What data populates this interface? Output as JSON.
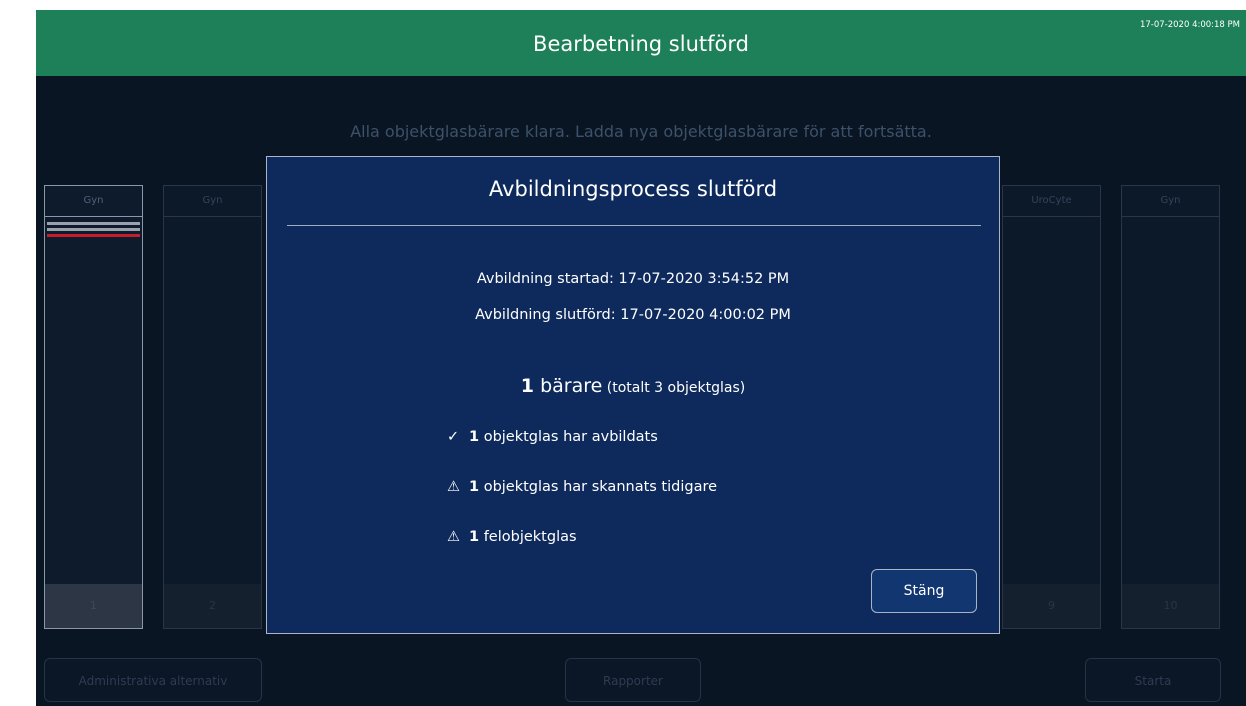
{
  "header": {
    "title": "Bearbetning slutförd",
    "clock": "17-07-2020 4:00:18 PM"
  },
  "subtitle": "Alla objektglasbärare klara. Ladda nya objektglasbärare för att fortsätta.",
  "carriers": [
    {
      "label": "Gyn",
      "number": "1"
    },
    {
      "label": "Gyn",
      "number": "2"
    },
    {
      "label": "UroCyte",
      "number": "9"
    },
    {
      "label": "Gyn",
      "number": "10"
    }
  ],
  "footer": {
    "admin_label": "Administrativa alternativ",
    "reports_label": "Rapporter",
    "start_label": "Starta"
  },
  "dialog": {
    "title": "Avbildningsprocess slutförd",
    "started": "Avbildning startad:  17-07-2020 3:54:52 PM",
    "finished": "Avbildning slutförd:  17-07-2020 4:00:02 PM",
    "summary_count": "1",
    "summary_unit": " bärare",
    "summary_extra": " (totalt 3 objektglas)",
    "items": [
      {
        "icon": "✓",
        "icon_name": "check-icon",
        "count": "1",
        "text": " objektglas har avbildats"
      },
      {
        "icon": "⚠",
        "icon_name": "warning-icon",
        "count": "1",
        "text": " objektglas har skannats tidigare"
      },
      {
        "icon": "⚠",
        "icon_name": "warning-icon",
        "count": "1",
        "text": " felobjektglas"
      }
    ],
    "close_label": "Stäng"
  },
  "colors": {
    "header_green": "#1e8058",
    "background": "#0a1524",
    "dialog_blue": "#0e2a5c",
    "error_red": "#c41d2b"
  }
}
